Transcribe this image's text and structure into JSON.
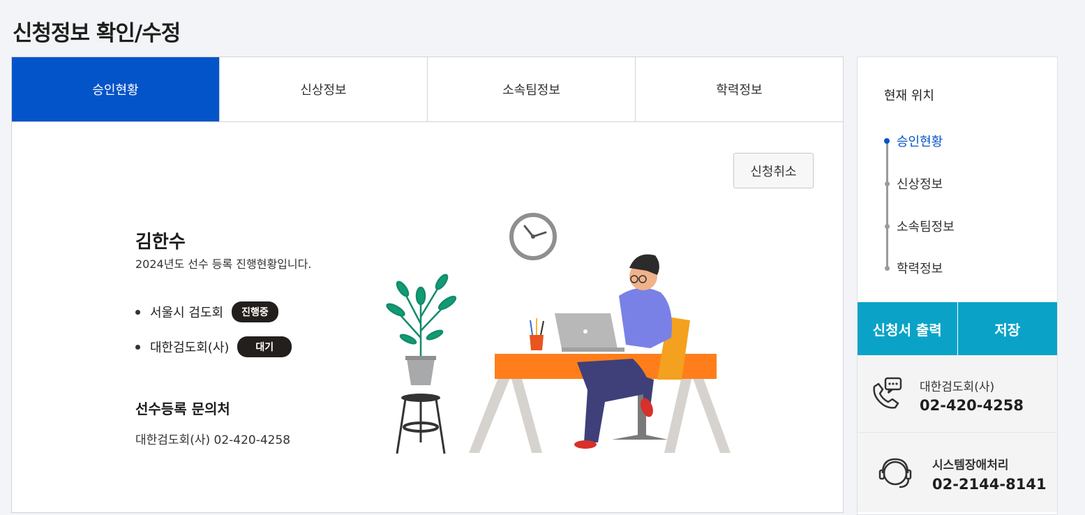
{
  "page": {
    "title": "신청정보 확인/수정"
  },
  "tabs": [
    {
      "label": "승인현황",
      "active": true
    },
    {
      "label": "신상정보",
      "active": false
    },
    {
      "label": "소속팀정보",
      "active": false
    },
    {
      "label": "학력정보",
      "active": false
    }
  ],
  "main": {
    "cancel_label": "신청취소",
    "user_name": "김한수",
    "user_sub": "2024년도 선수 등록 진행현황입니다.",
    "orgs": [
      {
        "name": "서울시 검도회",
        "status": "진행중"
      },
      {
        "name": "대한검도회(사)",
        "status": "대기"
      }
    ],
    "contact_title": "선수등록 문의처",
    "contact_value": "대한검도회(사) 02-420-4258"
  },
  "sidebar": {
    "location_title": "현재 위치",
    "location_items": [
      "승인현황",
      "신상정보",
      "소속팀정보",
      "학력정보"
    ],
    "print_label": "신청서 출력",
    "save_label": "저장",
    "contact1": {
      "name": "대한검도회(사)",
      "phone": "02-420-4258",
      "icon": "phone-chat-icon"
    },
    "contact2": {
      "name": "시스템장애처리",
      "phone": "02-2144-8141",
      "icon": "headset-icon"
    }
  },
  "colors": {
    "primary": "#0454c9",
    "accent": "#0aa3c7",
    "badge": "#231f1c"
  }
}
